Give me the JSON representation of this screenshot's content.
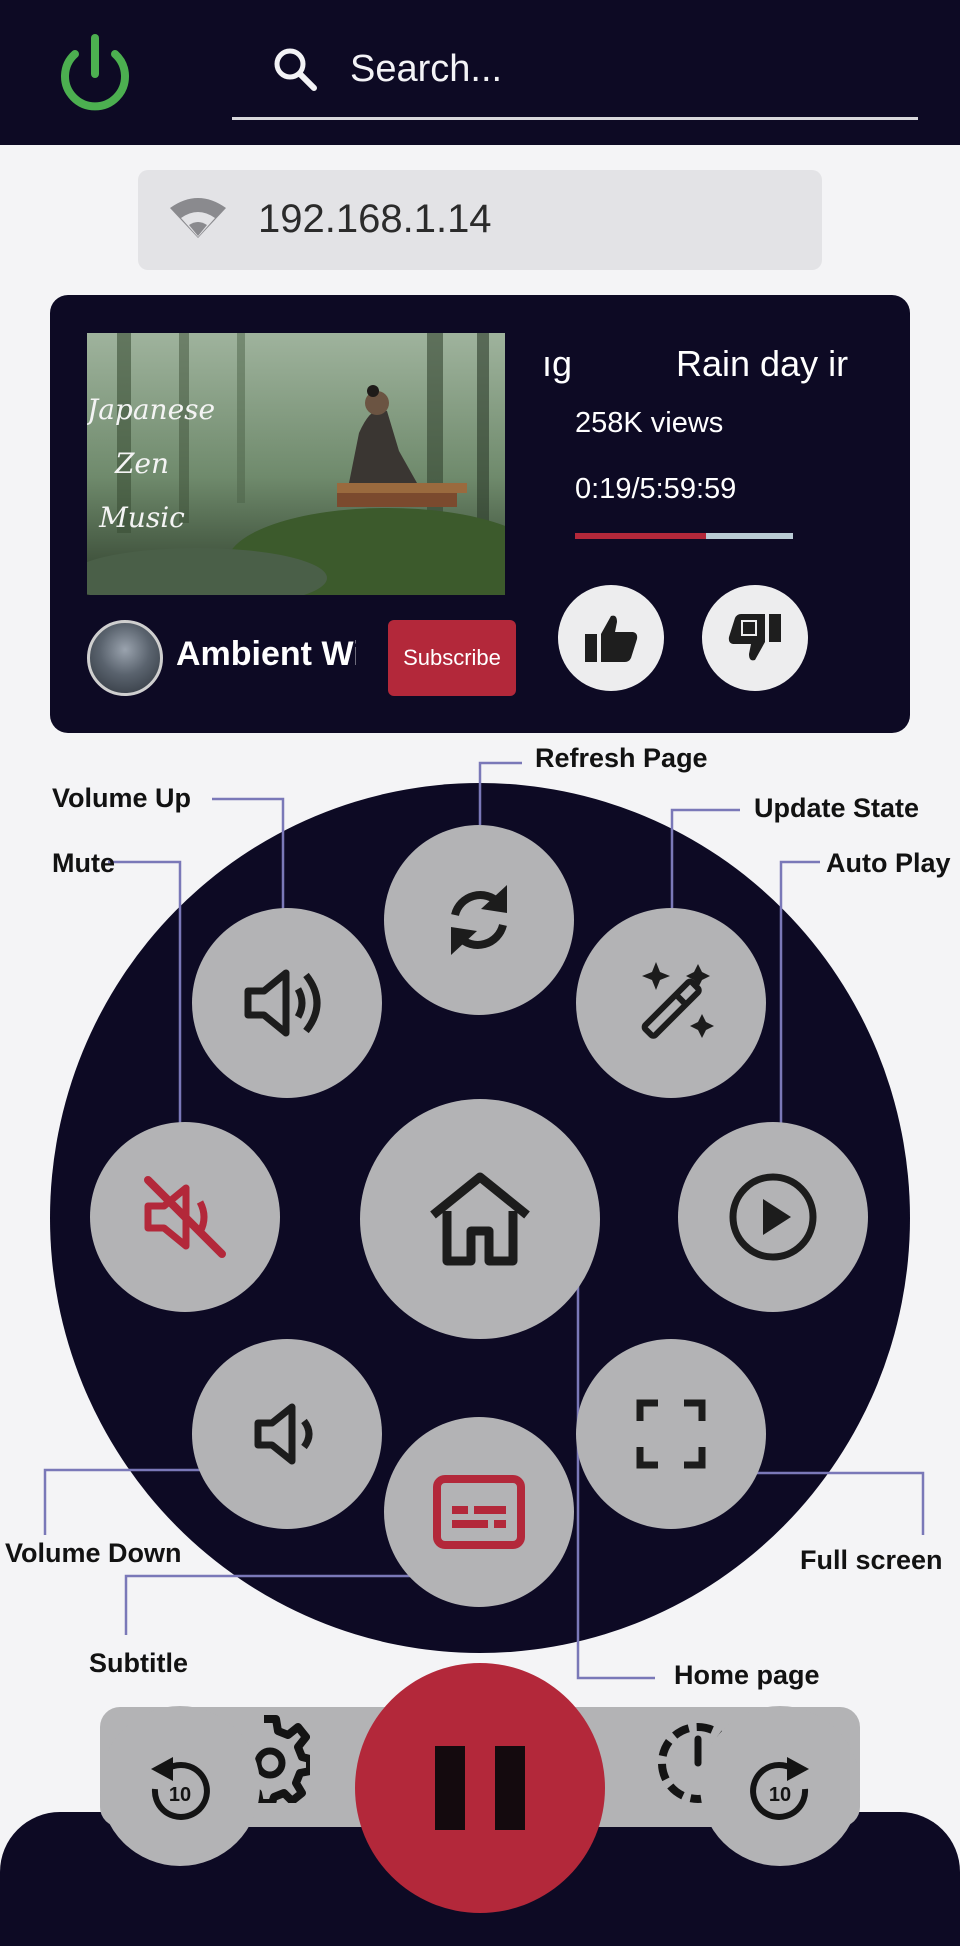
{
  "header": {
    "search": {
      "placeholder": "Search..."
    },
    "power_icon": "power-icon",
    "power_color": "#4caf50"
  },
  "connection": {
    "ip": "192.168.1.14",
    "icon": "wifi-icon"
  },
  "now_playing": {
    "thumbnail_text": [
      "Japanese",
      "Zen",
      "Music"
    ],
    "title_fragment_left": "ıg",
    "title_fragment_right": "Rain day ir",
    "views": "258K views",
    "timecode": "0:19/5:59:59",
    "progress_fraction": 0.6,
    "channel_name": "Ambient Wit",
    "subscribe_label": "Subscribe",
    "like_icon": "thumbs-up-icon",
    "dislike_icon": "thumbs-down-icon"
  },
  "callouts": {
    "refresh": "Refresh Page",
    "volume_up": "Volume Up",
    "update_state": "Update State",
    "mute": "Mute",
    "auto_play": "Auto Play",
    "volume_down": "Volume Down",
    "full_screen": "Full screen",
    "subtitle": "Subtitle",
    "home": "Home page"
  },
  "remote": {
    "buttons": [
      "refresh-icon",
      "volume-up-icon",
      "magic-wand-icon",
      "mute-icon",
      "home-icon",
      "play-circle-icon",
      "volume-down-icon",
      "fullscreen-icon",
      "subtitle-icon"
    ]
  },
  "transport": {
    "replay_seconds": "10",
    "forward_seconds": "10",
    "pause_icon": "pause-icon",
    "settings_icon": "gear-icon",
    "timer_icon": "timer-icon"
  },
  "colors": {
    "dark_navy": "#0d0a24",
    "accent_red": "#b3283a",
    "button_grey": "#b3b3b5",
    "callout_line": "#7a78b8"
  }
}
